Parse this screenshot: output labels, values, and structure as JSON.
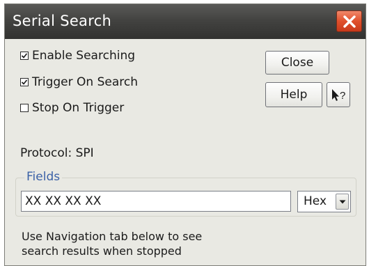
{
  "window": {
    "title": "Serial Search"
  },
  "options": {
    "enable_searching": {
      "label": "Enable Searching",
      "checked": true
    },
    "trigger_on_search": {
      "label": "Trigger On Search",
      "checked": true
    },
    "stop_on_trigger": {
      "label": "Stop On Trigger",
      "checked": false
    }
  },
  "buttons": {
    "close_label": "Close",
    "help_label": "Help",
    "whats_this_icon": "pointer-question-icon",
    "title_close_icon": "close-x-icon"
  },
  "protocol": {
    "text": "Protocol: SPI"
  },
  "fields": {
    "legend": "Fields",
    "value": "XX XX XX XX",
    "format": "Hex"
  },
  "footer": {
    "line1": "Use Navigation tab below to see",
    "line2": "search results when stopped"
  },
  "colors": {
    "title_bar": "#434341",
    "close_button": "#e0502c",
    "legend_text": "#3c62a7",
    "dialog_bg": "#e9e9e3"
  }
}
